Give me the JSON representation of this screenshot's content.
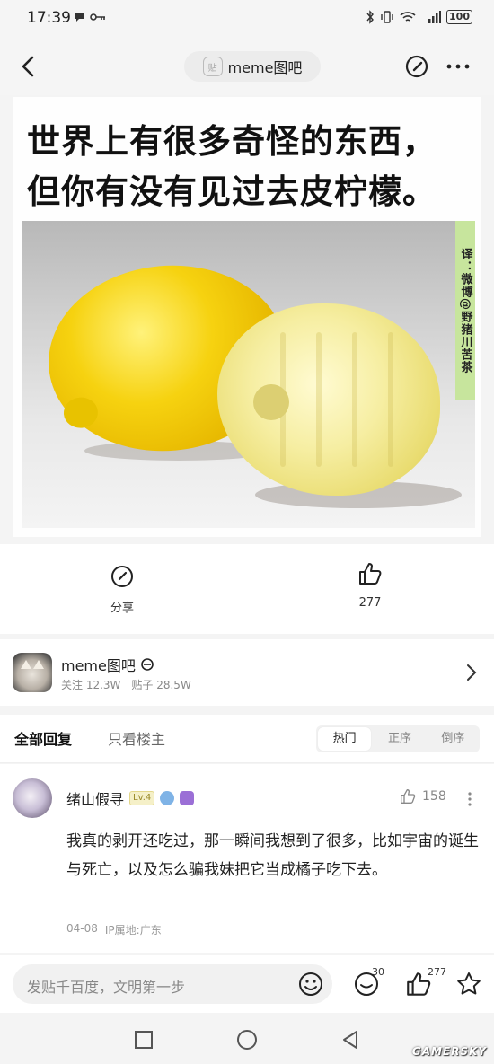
{
  "status_bar": {
    "time": "17:39",
    "battery": "100"
  },
  "nav": {
    "forum_name": "meme图吧",
    "logo_text": "贴"
  },
  "post": {
    "caption_line1": "世界上有很多奇怪的东西，",
    "caption_line2": "但你有没有见过去皮柠檬。",
    "watermark": "译：微博@野猪川苦茶"
  },
  "actions": {
    "share_label": "分享",
    "like_count": "277"
  },
  "forum_card": {
    "name": "meme图吧",
    "followers": "关注 12.3W",
    "posts": "贴子 28.5W"
  },
  "reply_tabs": {
    "all": "全部回复",
    "owner_only": "只看楼主",
    "sort_options": [
      "热门",
      "正序",
      "倒序"
    ],
    "active_sort": "热门"
  },
  "comment": {
    "username": "绪山假寻",
    "level": "Lv.4",
    "like_count": "158",
    "text": "我真的剥开还吃过，那一瞬间我想到了很多，比如宇宙的诞生与死亡，以及怎么骗我妹把它当成橘子吃下去。",
    "date": "04-08",
    "ip_location": "IP属地:广东"
  },
  "bottom_bar": {
    "placeholder": "发贴千百度，文明第一步",
    "comment_count": "30",
    "like_count": "277"
  },
  "watermark_site": "GAMERSKY",
  "colors": {
    "lemon_yellow": "#f6d210",
    "watermark_green": "#c7e59d",
    "text_primary": "#222222",
    "text_secondary": "#888888"
  }
}
